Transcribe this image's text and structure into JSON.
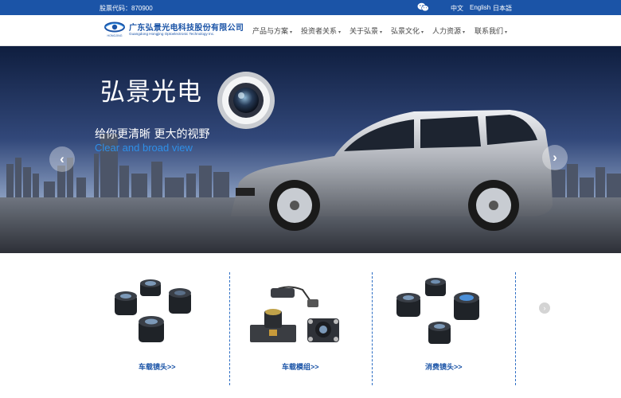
{
  "topbar": {
    "stock_code": "股票代码：870900",
    "wechat_icon": "wechat-icon",
    "languages": [
      "中文",
      "English",
      "日本語"
    ]
  },
  "header": {
    "company_name_cn": "广东弘景光电科技股份有限公司",
    "company_name_en": "Guangdong Hongjing Optoelectronic Technology Inc.",
    "logo_mark_text": "HONGJING",
    "nav": [
      "产品与方案",
      "投资者关系",
      "关于弘景",
      "弘景文化",
      "人力资源",
      "联系我们"
    ]
  },
  "banner": {
    "title": "弘景光电",
    "subtitle_cn": "给你更清晰 更大的视野",
    "subtitle_en": "Clear and broad view",
    "prev_icon": "chevron-left-icon",
    "next_icon": "chevron-right-icon"
  },
  "products": {
    "items": [
      {
        "label": "车载镜头>>"
      },
      {
        "label": "车载模组>>"
      },
      {
        "label": "消费镜头>>"
      }
    ],
    "next_icon": "chevron-right-icon"
  },
  "colors": {
    "brand_blue": "#1b54a7",
    "accent_blue": "#2e8fe8"
  }
}
